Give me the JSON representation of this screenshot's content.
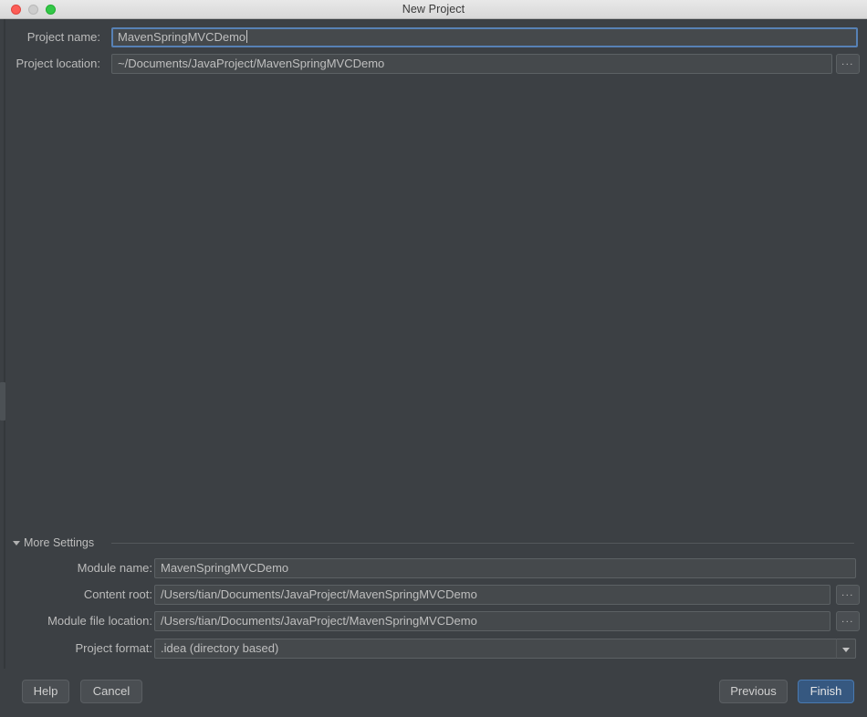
{
  "window": {
    "title": "New Project",
    "traffic_lights": {
      "close": "close-button",
      "minimize": "minimize-button",
      "maximize": "maximize-button"
    }
  },
  "form": {
    "project_name": {
      "label": "Project name:",
      "value": "MavenSpringMVCDemo"
    },
    "project_location": {
      "label": "Project location:",
      "value": "~/Documents/JavaProject/MavenSpringMVCDemo",
      "browse_label": "..."
    }
  },
  "more_settings": {
    "label": "More Settings",
    "expanded": true,
    "module_name": {
      "label": "Module name:",
      "value": "MavenSpringMVCDemo"
    },
    "content_root": {
      "label": "Content root:",
      "value": "/Users/tian/Documents/JavaProject/MavenSpringMVCDemo",
      "browse_label": "..."
    },
    "module_file_location": {
      "label": "Module file location:",
      "value": "/Users/tian/Documents/JavaProject/MavenSpringMVCDemo",
      "browse_label": "..."
    },
    "project_format": {
      "label": "Project format:",
      "value": ".idea (directory based)"
    }
  },
  "footer": {
    "help": "Help",
    "cancel": "Cancel",
    "previous": "Previous",
    "finish": "Finish"
  },
  "colors": {
    "background": "#3c4044",
    "field_background": "#45494c",
    "field_border": "#5c6164",
    "focus_border": "#5781b5",
    "text": "#bfbfbf",
    "primary_button": "#365880",
    "titlebar": "#e0e0e0"
  }
}
